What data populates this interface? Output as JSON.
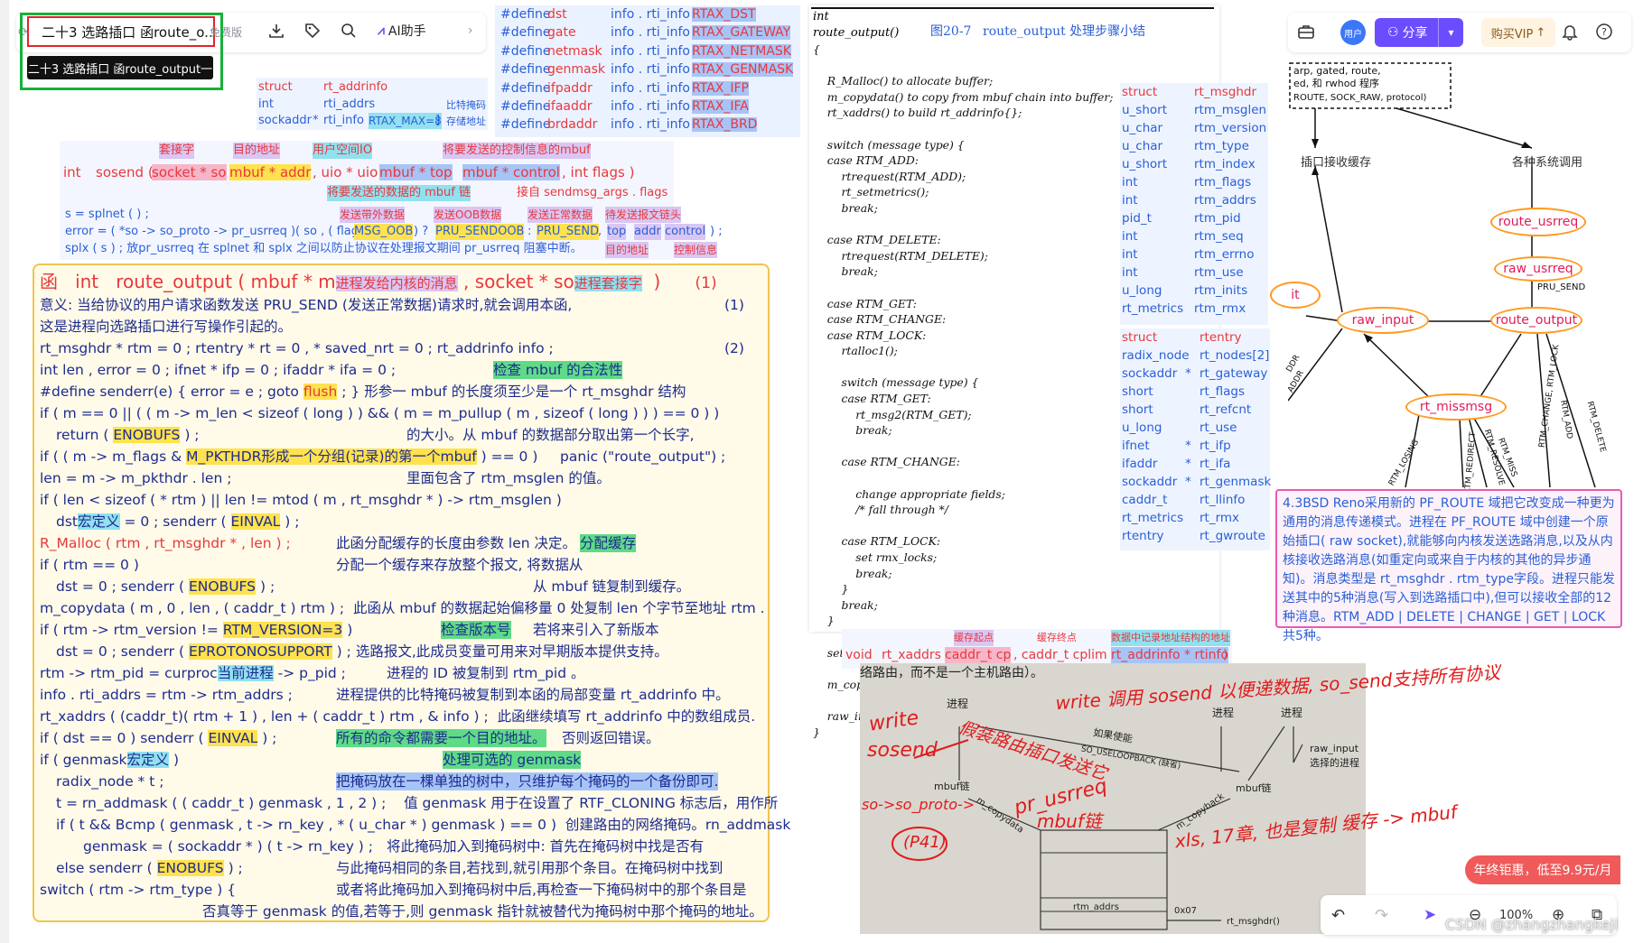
{
  "toolbar": {
    "doc_title": "二十3 选路插口 函route_o...",
    "free_tag": "免费版",
    "tooltip": "二十3 选路插口 函route_output一",
    "ai_label": "AI助手"
  },
  "right_toolbar": {
    "avatar": "用户",
    "share": "分享",
    "vip": "购买VIP"
  },
  "defines": [
    [
      "#define",
      "dst",
      "info . rti_info [",
      "RTAX_DST",
      "]"
    ],
    [
      "#define",
      "gate",
      "info . rti_info [",
      "RTAX_GATEWAY",
      "]"
    ],
    [
      "#define",
      "netmask",
      "info . rti_info [",
      "RTAX_NETMASK",
      "]"
    ],
    [
      "#define",
      "genmask",
      "info . rti_info [",
      "RTAX_GENMASK",
      "]"
    ],
    [
      "#define",
      "ifpaddr",
      "info . rti_info [",
      "RTAX_IFP",
      "]"
    ],
    [
      "#define",
      "ifaaddr",
      "info . rti_info [",
      "RTAX_IFA",
      "]"
    ],
    [
      "#define",
      "brdaddr",
      "info . rti_info [",
      "RTAX_BRD",
      "]"
    ]
  ],
  "addrinfo": {
    "row1a": "struct",
    "row1b": "rt_addrinfo",
    "row2a": "int",
    "row2b": "rti_addrs",
    "row2c": "比特掩码",
    "row3a": "sockaddr",
    "row3b": "*",
    "row3c": "rti_info [",
    "row3d": "RTAX_MAX=8",
    "row3e": "]",
    "row3f": "存储地址"
  },
  "sosend": {
    "l1": [
      "套接字",
      "目的地址",
      "用户空间IO",
      "将要发送的控制信息的mbuf"
    ],
    "sig_int": "int",
    "sig_name": "sosend (",
    "p1": "socket * so",
    "p2": "mbuf * addr",
    "p3": ", uio * uio ,",
    "p4": "mbuf * top",
    "p5": "mbuf * control",
    "p6": ", int flags )",
    "l3a": "将要发送的数据的 mbuf 链",
    "l3b": "接自 sendmsg_args . flags",
    "l4": "s = splnet ( ) ;",
    "l4a": "发送带外数据",
    "l4b": "发送OOB数据",
    "l4c": "发送正常数据",
    "l4d": "待发送报文链头",
    "l5": "error = ( *so -> so_proto -> pr_usrreq )( so , ( flags &",
    "l5a": "MSG_OOB",
    "l5b": ") ?",
    "l5c": "PRU_SENDOOB",
    "l5d": ":",
    "l5e": "PRU_SEND",
    "l5f": ",",
    "l5g": "top",
    "l5h": "addr",
    "l5i": "control",
    "l5j": ") ;",
    "l6": "splx ( s ) ;    放pr_usrreq 在 splnet 和 splx 之间以防止协议在处理报文期间 pr_usrreq 阻塞中断。",
    "l6a": "目的地址",
    "l6b": "控制信息"
  },
  "main": {
    "h_fn": "函",
    "h_int": "int",
    "h_name": "route_output ( mbuf * m",
    "h_m": "进程发给内核的消息",
    "h_so": ", socket * so",
    "h_so2": "进程套接字",
    "h_close": ")",
    "h_num": "(1)",
    "meaning1": "意义: 当给协议的用户请求函数发送 PRU_SEND (发送正常数据)请求时,就会调用本函,",
    "meaning1_num": "(1)",
    "meaning2": "这是进程向选路插口进行写操作引起的。",
    "l3": "rt_msghdr * rtm = 0 ;        rtentry * rt = 0 , * saved_nrt = 0 ;        rt_addrinfo  info ;",
    "l3_num": "(2)",
    "l4": "int  len , error = 0 ;        ifnet * ifp = 0 ;      ifaddr * ifa = 0 ;",
    "l4_hl": "检查 mbuf 的合法性",
    "l5a": "#define     senderr(e)     { error = e ;   goto",
    "l5b": "flush",
    "l5c": "; }     形参一  mbuf 的长度须至少是一个 rt_msghdr 结构",
    "l6": "if ( m == 0 || ( ( m -> m_len < sizeof ( long ) )  &&  ( m = m_pullup ( m , sizeof ( long ) ) )  == 0 ) )",
    "l7a": "return (",
    "l7b": "ENOBUFS",
    "l7c": ") ;",
    "l7d": "的大小。从 mbuf 的数据部分取出第一个长字,",
    "l8a": "if ( ( m -> m_flags  &",
    "l8b": "M_PKTHDR形成一个分组(记录)的第一个mbuf",
    "l8c": ") == 0 )",
    "l8d": "panic (\"route_output\") ;",
    "l9": "len = m -> m_pkthdr . len ;",
    "l9b": "里面包含了 rtm_msglen 的值。",
    "l10": "if ( len < sizeof ( * rtm )  ||  len != mtod ( m , rt_msghdr * ) -> rtm_msglen )",
    "l11a": "dst",
    "l11b": "宏定义",
    "l11c": "= 0 ;        senderr (",
    "l11d": "EINVAL",
    "l11e": ") ;",
    "l12a": "R_Malloc ( rtm , rt_msghdr * , len ) ;",
    "l12b": "此函分配缓存的长度由参数 len 决定。",
    "l12c": "分配缓存",
    "l13a": "if ( rtm == 0 )",
    "l13b": "分配一个缓存来存放整个报文,  将数据从",
    "l14a": "dst = 0 ;      senderr (",
    "l14b": "ENOBUFS",
    "l14c": ") ;",
    "l14d": "从 mbuf 链复制到缓存。",
    "l15a": "m_copydata  ( m , 0 , len , ( caddr_t ) rtm ) ;",
    "l15b": "此函从 mbuf 的数据起始偏移量 0 处复制 len 个字节至地址 rtm .",
    "l16a": "if ( rtm -> rtm_version  !=",
    "l16b": "RTM_VERSION=3",
    "l16c": ")",
    "l16d": "检查版本号",
    "l16e": "若将来引入了新版本",
    "l17a": "dst = 0 ;      senderr (",
    "l17b": "EPROTONOSUPPORT",
    "l17c": ") ;",
    "l17d": "选路报文,此成员变量可用来对早期版本提供支持。",
    "l18a": "rtm -> rtm_pid = curproc",
    "l18b": "当前进程",
    "l18c": "-> p_pid ;",
    "l18d": "进程的 ID 被复制到 rtm_pid 。",
    "l19a": "info . rti_addrs = rtm -> rtm_addrs ;",
    "l19b": "进程提供的比特掩码被复制到本函的局部变量 rt_addrinfo 中。",
    "l20a": "rt_xaddrs ( (caddr_t)( rtm + 1 ) , len + ( caddr_t ) rtm , & info ) ;",
    "l20b": "此函继续填写 rt_addrinfo 中的数组成员.",
    "l21a": "if ( dst == 0 )        senderr (",
    "l21b": "EINVAL",
    "l21c": ") ;",
    "l21d": "所有的命令都需要一个目的地址。",
    "l21e": "否则返回错误。",
    "l22a": "if ( genmask",
    "l22b": "宏定义",
    "l22c": ")",
    "l22d": "处理可选的 genmask",
    "l23a": "radix_node * t ;",
    "l23b": "把掩码放在一棵单独的树中，只维护每个掩码的一个备份即可.",
    "l24a": "t = rn_addmask ( ( caddr_t ) genmask , 1 , 2 ) ;",
    "l24b": "值 genmask 用于在设置了 RTF_CLONING 标志后，用作所",
    "l25a": "if ( t && Bcmp ( genmask , t -> rn_key , * ( u_char * ) genmask ) == 0 )",
    "l25b": "创建路由的网络掩码。rn_addmask",
    "l26a": "genmask = ( sockaddr * ) ( t -> rn_key ) ;",
    "l26b": "将此掩码加入到掩码树中:  首先在掩码树中找是否有",
    "l27a": "else      senderr (",
    "l27b": "ENOBUFS",
    "l27c": ") ;",
    "l27d": "与此掩码相同的条目,若找到,就引用那个条目。在掩码树中找到",
    "l28a": "switch ( rtm -> rtm_type ) {",
    "l28b": "或者将此掩码加入到掩码树中后,再检查一下掩码树中的那个条目是",
    "l29": "否真等于 genmask 的值,若等于,则 genmask 指针就被替代为掩码树中那个掩码的地址。"
  },
  "code": {
    "l0": "int",
    "l1": "route_output()",
    "fig_label": "图20-7",
    "fig_caption": "route_output  处理步骤小结",
    "body": "{\n\n    R_Malloc() to allocate buffer;\n    m_copydata() to copy from mbuf chain into buffer;\n    rt_xaddrs() to build rt_addrinfo{};\n\n    switch (message type) {\n    case RTM_ADD:\n        rtrequest(RTM_ADD);\n        rt_setmetrics();\n        break;\n\n    case RTM_DELETE:\n        rtrequest(RTM_DELETE);\n        break;\n\n    case RTM_GET:\n    case RTM_CHANGE:\n    case RTM_LOCK:\n        rtalloc1();\n\n        switch (message type) {\n        case RTM_GET:\n            rt_msg2(RTM_GET);\n            break;\n\n        case RTM_CHANGE:\n\n            change appropriate fields;\n            /* fall through */\n\n        case RTM_LOCK:\n            set rmx_locks;\n            break;\n        }\n        break;\n    }\n\n    set rtm_error if error, else set RTF_DONE flag;\n\n    m_copyback() to copy from buffer into mbuf chain;\n\n    raw_input();      /* mbuf chain to appropriate processes */\n}"
  },
  "struct_msghdr": {
    "types": [
      "struct",
      "u_short",
      "u_char",
      "u_char",
      "u_short",
      "int",
      "int",
      "pid_t",
      "int",
      "int",
      "int",
      "u_long",
      "rt_metrics"
    ],
    "names": [
      "rt_msghdr",
      "rtm_msglen",
      "rtm_version",
      "rtm_type",
      "rtm_index",
      "rtm_flags",
      "rtm_addrs",
      "rtm_pid",
      "rtm_seq",
      "rtm_errno",
      "rtm_use",
      "rtm_inits",
      "rtm_rmx"
    ]
  },
  "struct_rtentry": {
    "types": [
      "struct",
      "radix_node",
      "sockaddr",
      "short",
      "short",
      "u_long",
      "ifnet",
      "ifaddr",
      "sockaddr",
      "caddr_t",
      "rt_metrics",
      "rtentry"
    ],
    "stars": [
      "",
      "",
      "*",
      "",
      "",
      "",
      "*",
      "*",
      "*",
      "",
      "",
      ""
    ],
    "names": [
      "rtentry",
      "rt_nodes[2]",
      "rt_gateway",
      "rt_flags",
      "rt_refcnt",
      "rt_use",
      "rt_ifp",
      "rt_ifa",
      "rt_genmask",
      "rt_llinfo",
      "rt_rmx",
      "rt_gwroute"
    ]
  },
  "xaddrs": {
    "a1": "缓存起点",
    "a2": "缓存终点",
    "a3": "数据中记录地址结构的地址",
    "void": "void",
    "name": "rt_xaddrs (",
    "p1": "caddr_t  cp",
    "p2": ", caddr_t  cplim ,",
    "p3": "rt_addrinfo  * rtinfo",
    "p4": ")"
  },
  "diagram": {
    "top_text1": "arp, gated, route,",
    "top_text2": "ed, 和 rwhod 程序",
    "top_text3": "ROUTE, SOCK_RAW, protocol)",
    "label_buf": "插口接收缓存",
    "label_calls": "各种系统调用",
    "ovals": [
      "route_usrreq",
      "raw_usrreq",
      "raw_input",
      "route_output",
      "rt_missmsg",
      "it"
    ],
    "pru_send": "PRU_SEND",
    "edges": [
      "RTM_LOSING",
      "RTM_REDIRECT",
      "RTM_RESOLVE",
      "RTM_MISS",
      "RTM_CHANGE, RTM_LOCK",
      "RTM_ADD",
      "RTM_DELETE",
      "ADDR",
      "DDR"
    ]
  },
  "note": {
    "text": "4.3BSD Reno采用新的 PF_ROUTE 域把它改变成一种更为通用的消息传递模式。进程在 PF_ROUTE 域中创建一个原始插口( raw socket),就能够向内核发送选路消息,以及从内核接收选路消息(如重定向或来自于内核的其他的异步通知)。消息类型是 rt_msghdr . rtm_type字段。进程只能发送其中的5种消息(写入到选路插口中),但可以接收全部的12种消息。RTM_ADD | DELETE | CHANGE | GET | LOCK 共5种。"
  },
  "photo": {
    "top": "络路由，而不是一个主机路由）。",
    "hw1": "write 调用 sosend 以便递数据, so_send支持所有协议",
    "hw2": "write",
    "hw3": "sosend",
    "hw4": "so->so_proto->",
    "hw5": "pr_usrreq",
    "hw6": "(P41)",
    "hw7": "mbuf链",
    "hw8": "xls, 17章, 也是复制 缓存 -> mbuf",
    "hw9": "假装路由插口发送它",
    "p1": "进程",
    "p2": "进程",
    "p3": "进程",
    "p4": "如果使能",
    "p5": "SO_USELOOPBACK (缺省)",
    "p6": "mbuf链",
    "p7": "mbuf链",
    "p8": "raw_input",
    "p9": "选择的进程",
    "p10": "m_copydata",
    "p11": "m_copyback",
    "p12": "rtm_addrs",
    "p13": "0x07",
    "p14": "rt_msghdr()"
  },
  "bottom": {
    "zoom": "100%",
    "promo": "年终钜惠，低至9.9元/月",
    "watermark": "CSDN @zhangzhangkeji"
  },
  "colors": {
    "accent": "#6b4dff",
    "red_annot": "#e0242b",
    "green_annot": "#16b13a",
    "diagram_oval": "#ff9a1f"
  }
}
